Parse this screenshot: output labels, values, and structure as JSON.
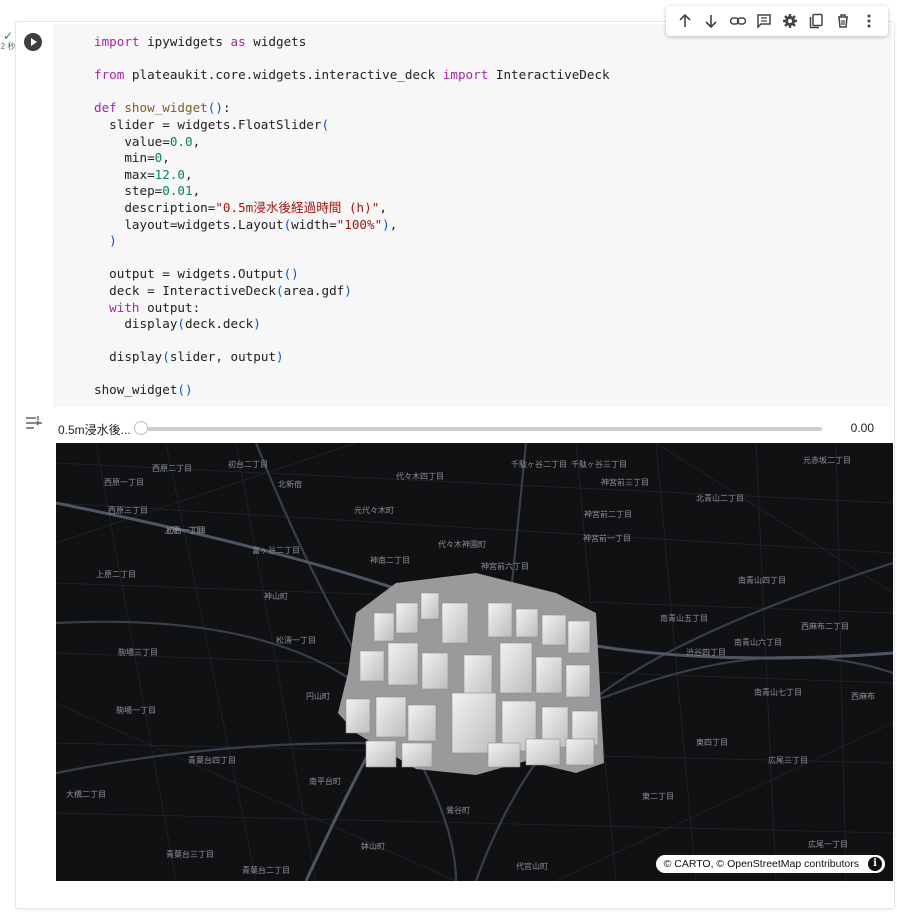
{
  "exec": {
    "check": "✓",
    "time": "2 秒"
  },
  "toolbar": {
    "buttons": [
      {
        "icon": "arrow-up-icon"
      },
      {
        "icon": "arrow-down-icon"
      },
      {
        "icon": "link-icon"
      },
      {
        "icon": "comment-icon"
      },
      {
        "icon": "gear-icon"
      },
      {
        "icon": "mirror-cell-icon"
      },
      {
        "icon": "trash-icon"
      },
      {
        "icon": "more-vert-icon"
      }
    ]
  },
  "code": {
    "lines": [
      "import ipywidgets as widgets",
      "",
      "from plateaukit.core.widgets.interactive_deck import InteractiveDeck",
      "",
      "def show_widget():",
      "  slider = widgets.FloatSlider(",
      "    value=0.0,",
      "    min=0,",
      "    max=12.0,",
      "    step=0.01,",
      "    description=\"0.5m浸水後経過時間 (h)\",",
      "    layout=widgets.Layout(width=\"100%\"),",
      "  )",
      "",
      "  output = widgets.Output()",
      "  deck = InteractiveDeck(area.gdf)",
      "  with output:",
      "    display(deck.deck)",
      "",
      "  display(slider, output)",
      "",
      "show_widget()"
    ]
  },
  "slider": {
    "label": "0.5m浸水後...",
    "value_text": "0.00",
    "value": 0.0,
    "min": 0,
    "max": 12.0
  },
  "map": {
    "labels": [
      "初台二丁目",
      "西原二丁目",
      "千駄ヶ谷二丁目",
      "千駄ヶ谷三丁目",
      "元赤坂二丁目",
      "西原一丁目",
      "北新宿",
      "代々木四丁目",
      "西原三丁目",
      "初台一丁目",
      "神宮前三丁目",
      "北青山二丁目",
      "元代々木町",
      "代々木神園町",
      "神宮前二丁目",
      "上原一丁目",
      "富ヶ谷二丁目",
      "神宮前一丁目",
      "上原二丁目",
      "神南二丁目",
      "神宮前六丁目",
      "南青山四丁目",
      "神山町",
      "南青山五丁目",
      "松濤一丁目",
      "駒場三丁目",
      "渋谷四丁目",
      "南青山六丁目",
      "西麻布二丁目",
      "円山町",
      "南青山七丁目",
      "駒場一丁目",
      "西麻布",
      "青葉台四丁目",
      "南平台町",
      "東四丁目",
      "広尾三丁目",
      "大橋二丁目",
      "鶯谷町",
      "東二丁目",
      "鉢山町",
      "青葉台三丁目",
      "代官山町",
      "広尾一丁目",
      "青葉台二丁目"
    ],
    "attribution": "© CARTO, © OpenStreetMap contributors",
    "info": "i"
  }
}
